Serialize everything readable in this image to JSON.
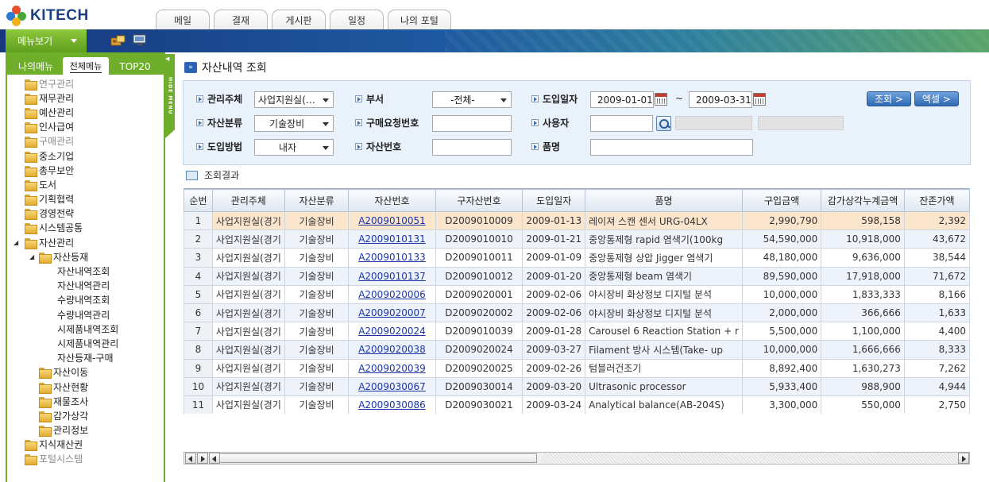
{
  "brand": {
    "name": "KITECH"
  },
  "top_tabs": [
    "메일",
    "결재",
    "게시판",
    "일정",
    "나의 포털"
  ],
  "menu_button": {
    "label": "메뉴보기"
  },
  "sidebar": {
    "tabs": [
      "나의메뉴",
      "전체메뉴",
      "TOP20"
    ],
    "active_tab": "전체메뉴",
    "hide_label": "HIDE MENU",
    "items": [
      {
        "label": "연구관리",
        "level": 0,
        "dim": true
      },
      {
        "label": "재무관리",
        "level": 0
      },
      {
        "label": "예산관리",
        "level": 0
      },
      {
        "label": "인사급여",
        "level": 0
      },
      {
        "label": "구매관리",
        "level": 0,
        "dim": true
      },
      {
        "label": "중소기업",
        "level": 0
      },
      {
        "label": "총무보안",
        "level": 0
      },
      {
        "label": "도서",
        "level": 0
      },
      {
        "label": "기획협력",
        "level": 0
      },
      {
        "label": "경영전략",
        "level": 0
      },
      {
        "label": "시스템공통",
        "level": 0
      },
      {
        "label": "자산관리",
        "level": 0,
        "expanded": true
      },
      {
        "label": "자산등재",
        "level": 1,
        "expanded": true
      },
      {
        "label": "자산내역조회",
        "level": 2
      },
      {
        "label": "자산내역관리",
        "level": 2
      },
      {
        "label": "수량내역조회",
        "level": 2
      },
      {
        "label": "수량내역관리",
        "level": 2
      },
      {
        "label": "시제품내역조회",
        "level": 2
      },
      {
        "label": "시제품내역관리",
        "level": 2
      },
      {
        "label": "자산등재-구매",
        "level": 2
      },
      {
        "label": "자산이동",
        "level": 1
      },
      {
        "label": "자산현황",
        "level": 1
      },
      {
        "label": "재물조사",
        "level": 1
      },
      {
        "label": "감가상각",
        "level": 1
      },
      {
        "label": "관리정보",
        "level": 1
      },
      {
        "label": "지식재산권",
        "level": 0
      },
      {
        "label": "포털시스템",
        "level": 0,
        "dim": true
      }
    ]
  },
  "page": {
    "title": "자산내역 조회",
    "result_label": "조회결과"
  },
  "search": {
    "mgmt_label": "관리주체",
    "mgmt_value": "사업지원실(…",
    "dept_label": "부서",
    "dept_value": "-전체-",
    "date_label": "도입일자",
    "date_from": "2009-01-01",
    "date_sep": "~",
    "date_to": "2009-03-31",
    "class_label": "자산분류",
    "class_value": "기술장비",
    "req_label": "구매요청번호",
    "req_value": "",
    "user_label": "사용자",
    "user_value": "",
    "method_label": "도입방법",
    "method_value": "내자",
    "asset_no_label": "자산번호",
    "asset_no_value": "",
    "item_label": "품명",
    "item_value": "",
    "btn_search": "조회 >",
    "btn_excel": "엑셀 >"
  },
  "table": {
    "headers": [
      "순번",
      "관리주체",
      "자산분류",
      "자산번호",
      "구자산번호",
      "도입일자",
      "품명",
      "구입금액",
      "감가상각누계금액",
      "잔존가액"
    ],
    "rows": [
      [
        "1",
        "사업지원실(경기",
        "기술장비",
        "A2009010051",
        "D2009010009",
        "2009-01-13",
        "레이져 스캔 센서 URG-04LX",
        "2,990,790",
        "598,158",
        "2,392"
      ],
      [
        "2",
        "사업지원실(경기",
        "기술장비",
        "A2009010131",
        "D2009010010",
        "2009-01-21",
        "중앙통제형 rapid 염색기(100kg",
        "54,590,000",
        "10,918,000",
        "43,672"
      ],
      [
        "3",
        "사업지원실(경기",
        "기술장비",
        "A2009010133",
        "D2009010011",
        "2009-01-09",
        "중앙통제형 상압 Jigger 염색기",
        "48,180,000",
        "9,636,000",
        "38,544"
      ],
      [
        "4",
        "사업지원실(경기",
        "기술장비",
        "A2009010137",
        "D2009010012",
        "2009-01-20",
        "중앙통제형 beam 염색기",
        "89,590,000",
        "17,918,000",
        "71,672"
      ],
      [
        "5",
        "사업지원실(경기",
        "기술장비",
        "A2009020006",
        "D2009020001",
        "2009-02-06",
        "야시장비 화상정보 디지털 분석",
        "10,000,000",
        "1,833,333",
        "8,166"
      ],
      [
        "6",
        "사업지원실(경기",
        "기술장비",
        "A2009020007",
        "D2009020002",
        "2009-02-06",
        "야시장비 화상정보 디지털 분석",
        "2,000,000",
        "366,666",
        "1,633"
      ],
      [
        "7",
        "사업지원실(경기",
        "기술장비",
        "A2009020024",
        "D2009010039",
        "2009-01-28",
        "Carousel 6 Reaction Station + r",
        "5,500,000",
        "1,100,000",
        "4,400"
      ],
      [
        "8",
        "사업지원실(경기",
        "기술장비",
        "A2009020038",
        "D2009020024",
        "2009-03-27",
        "Filament 방사 시스템(Take- up",
        "10,000,000",
        "1,666,666",
        "8,333"
      ],
      [
        "9",
        "사업지원실(경기",
        "기술장비",
        "A2009020039",
        "D2009020025",
        "2009-02-26",
        "텀블러건조기",
        "8,892,400",
        "1,630,273",
        "7,262"
      ],
      [
        "10",
        "사업지원실(경기",
        "기술장비",
        "A2009030067",
        "D2009030014",
        "2009-03-20",
        "Ultrasonic processor",
        "5,933,400",
        "988,900",
        "4,944"
      ],
      [
        "11",
        "사업지원실(경기",
        "기술장비",
        "A2009030086",
        "D2009030021",
        "2009-03-24",
        "Analytical balance(AB-204S)",
        "3,300,000",
        "550,000",
        "2,750"
      ]
    ],
    "selected_row": 0
  },
  "colors": {
    "brand_blue": "#1b3f84",
    "sidebar_green": "#6fae2b",
    "link": "#1a35a8",
    "selected_row": "#fbe6cd"
  }
}
